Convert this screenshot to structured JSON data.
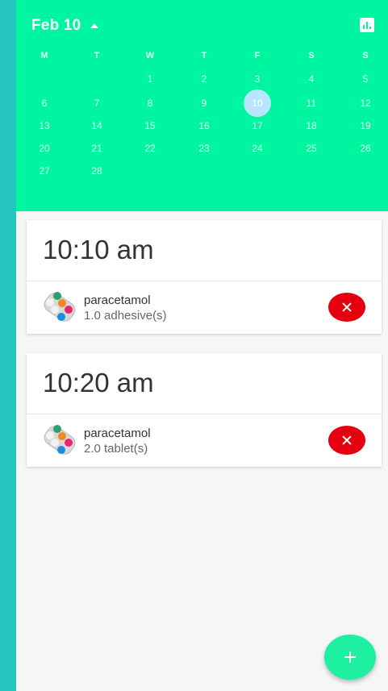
{
  "calendar": {
    "month_label": "Feb 10",
    "weekdays": [
      "M",
      "T",
      "W",
      "T",
      "F",
      "S",
      "S"
    ],
    "weeks": [
      [
        "",
        "",
        "1",
        "2",
        "3",
        "4",
        "5"
      ],
      [
        "6",
        "7",
        "8",
        "9",
        "10",
        "11",
        "12"
      ],
      [
        "13",
        "14",
        "15",
        "16",
        "17",
        "18",
        "19"
      ],
      [
        "20",
        "21",
        "22",
        "23",
        "24",
        "25",
        "26"
      ],
      [
        "27",
        "28",
        "",
        "",
        "",
        "",
        ""
      ]
    ],
    "selected_day": "10"
  },
  "schedule": [
    {
      "time": "10:10 am",
      "medicines": [
        {
          "name": "paracetamol",
          "dose": "1.0 adhesive(s)"
        }
      ]
    },
    {
      "time": "10:20 am",
      "medicines": [
        {
          "name": "paracetamol",
          "dose": "2.0 tablet(s)"
        }
      ]
    }
  ],
  "icons": {
    "stats": "bar-chart-icon",
    "delete": "close-icon",
    "add": "plus-icon",
    "medicine": "pill-pack-icon"
  },
  "colors": {
    "header": "#00f5a0",
    "side_strip": "#26c6c0",
    "delete": "#e4000f",
    "fab": "#1df0a0",
    "selected_day": "#b8e6ff"
  }
}
